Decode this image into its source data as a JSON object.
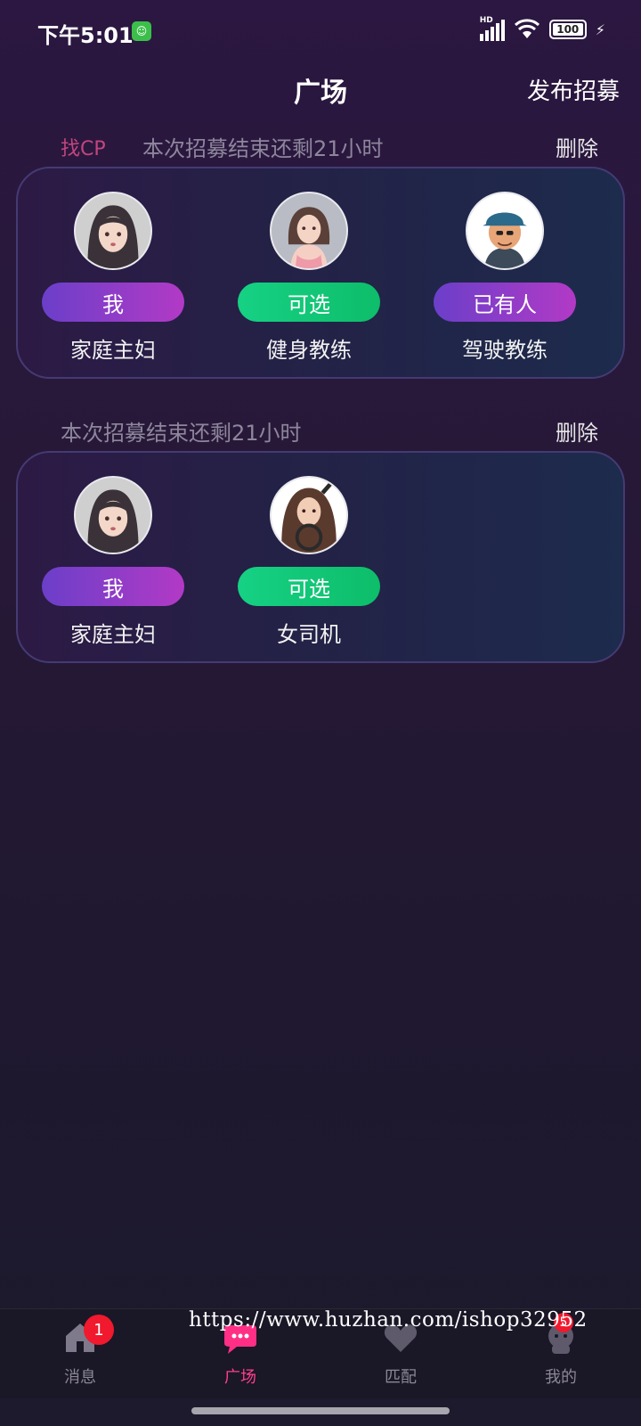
{
  "status_bar": {
    "time": "下午5:01",
    "app_icon": "app-notification-icon",
    "network": "HD",
    "battery": "100"
  },
  "header": {
    "title": "广场",
    "publish": "发布招募"
  },
  "recruitments": [
    {
      "tag": "找CP",
      "countdown": "本次招募结束还剩21小时",
      "delete": "删除",
      "slots": [
        {
          "status": "我",
          "role": "家庭主妇",
          "avatar": "housewife-avatar"
        },
        {
          "status": "可选",
          "role": "健身教练",
          "avatar": "fitness-coach-avatar"
        },
        {
          "status": "已有人",
          "role": "驾驶教练",
          "avatar": "driving-instructor-avatar"
        }
      ]
    },
    {
      "tag": "",
      "countdown": "本次招募结束还剩21小时",
      "delete": "删除",
      "slots": [
        {
          "status": "我",
          "role": "家庭主妇",
          "avatar": "housewife-avatar"
        },
        {
          "status": "可选",
          "role": "女司机",
          "avatar": "female-driver-avatar"
        }
      ]
    }
  ],
  "tabbar": {
    "items": [
      {
        "label": "消息",
        "icon": "home-icon",
        "badge": "1"
      },
      {
        "label": "广场",
        "icon": "chat-bubble-icon"
      },
      {
        "label": "匹配",
        "icon": "heart-icon"
      },
      {
        "label": "我的",
        "icon": "profile-icon",
        "badge": "5"
      }
    ],
    "active_color": "#ff3f8e"
  },
  "watermark": "https://www.huzhan.com/ishop32952",
  "colors": {
    "accent_pink": "#ff3f8e",
    "pill_me": "#8e3dc8",
    "pill_open": "#12c878",
    "card_border": "#443b73"
  }
}
